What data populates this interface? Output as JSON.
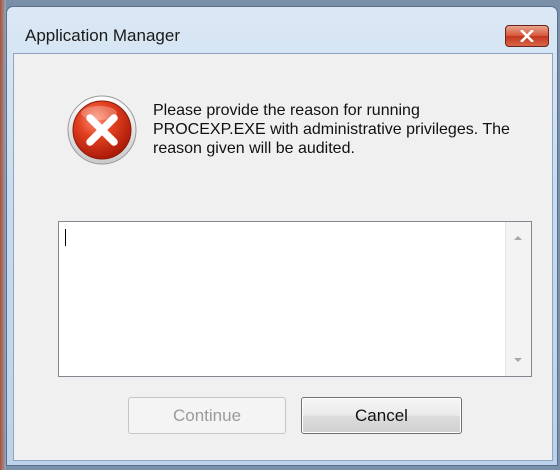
{
  "window": {
    "title": "Application Manager",
    "close_icon": "close-icon"
  },
  "dialog": {
    "icon": "error-icon",
    "message": "Please provide the reason for running PROCEXP.EXE with administrative privileges. The reason given will be audited.",
    "reason_input": {
      "value": "",
      "placeholder": ""
    },
    "buttons": {
      "continue_label": "Continue",
      "continue_enabled": false,
      "cancel_label": "Cancel"
    }
  },
  "colors": {
    "close_button": "#c2361c",
    "error_icon": "#d8301c",
    "disabled_text": "#9a9a9a"
  }
}
